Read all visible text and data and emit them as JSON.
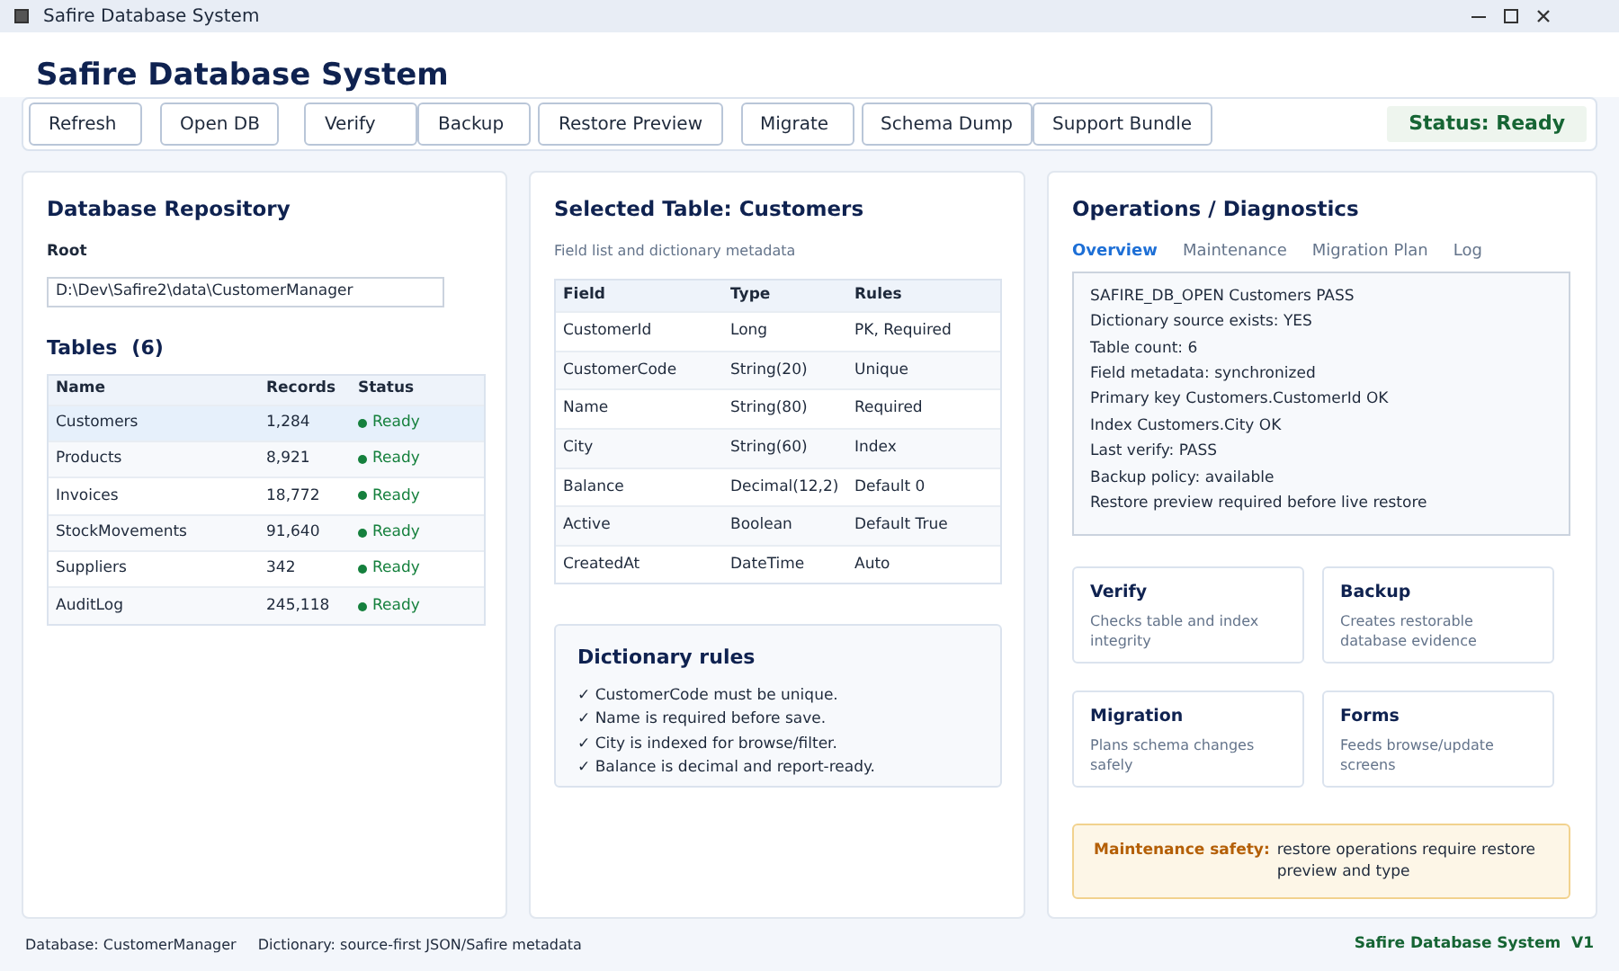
{
  "window": {
    "title": "Safire Database System"
  },
  "app_title": "Safire Database System",
  "toolbar": {
    "buttons": [
      "Refresh",
      "Open DB",
      "Verify",
      "Backup",
      "Restore Preview",
      "Migrate",
      "Schema Dump",
      "Support Bundle"
    ],
    "status": "Status: Ready"
  },
  "repository": {
    "title": "Database Repository",
    "root_label": "Root",
    "root_value": "D:\\Dev\\Safire2\\data\\CustomerManager",
    "tables_title": "Tables",
    "tables_count": "(6)",
    "columns": [
      "Name",
      "Records",
      "Status"
    ],
    "rows": [
      {
        "name": "Customers",
        "records": "1,284",
        "status": "Ready",
        "color": "#15803d",
        "selected": true
      },
      {
        "name": "Products",
        "records": "8,921",
        "status": "Ready",
        "color": "#15803d",
        "selected": false
      },
      {
        "name": "Invoices",
        "records": "18,772",
        "status": "Ready",
        "color": "#15803d",
        "selected": false
      },
      {
        "name": "StockMovements",
        "records": "91,640",
        "status": "Ready",
        "color": "#15803d",
        "selected": false
      },
      {
        "name": "Suppliers",
        "records": "342",
        "status": "Ready",
        "color": "#15803d",
        "selected": false
      },
      {
        "name": "AuditLog",
        "records": "245,118",
        "status": "Ready",
        "color": "#15803d",
        "selected": false
      }
    ]
  },
  "selected_table": {
    "title": "Selected Table: Customers",
    "subtitle": "Field list and dictionary metadata",
    "columns": [
      "Field",
      "Type",
      "Rules"
    ],
    "rows": [
      [
        "CustomerId",
        "Long",
        "PK, Required"
      ],
      [
        "CustomerCode",
        "String(20)",
        "Unique"
      ],
      [
        "Name",
        "String(80)",
        "Required"
      ],
      [
        "City",
        "String(60)",
        "Index"
      ],
      [
        "Balance",
        "Decimal(12,2)",
        "Default 0"
      ],
      [
        "Active",
        "Boolean",
        "Default True"
      ],
      [
        "CreatedAt",
        "DateTime",
        "Auto"
      ]
    ],
    "rules_title": "Dictionary rules",
    "rules": [
      "✓ CustomerCode must be unique.",
      "✓ Name is required before save.",
      "✓ City is indexed for browse/filter.",
      "✓ Balance is decimal and report-ready."
    ]
  },
  "operations": {
    "title": "Operations / Diagnostics",
    "tabs": [
      {
        "label": "Overview",
        "selected": true
      },
      {
        "label": "Maintenance",
        "selected": false
      },
      {
        "label": "Migration Plan",
        "selected": false
      },
      {
        "label": "Log",
        "selected": false
      }
    ],
    "log": [
      "SAFIRE_DB_OPEN Customers PASS",
      "Dictionary source exists: YES",
      "Table count: 6",
      "Field metadata: synchronized",
      "Primary key Customers.CustomerId OK",
      "Index Customers.City OK",
      "Last verify: PASS",
      "Backup policy: available",
      "Restore preview required before live restore"
    ],
    "cards": [
      {
        "title": "Verify",
        "text": "Checks table and index integrity"
      },
      {
        "title": "Backup",
        "text": "Creates restorable database evidence"
      },
      {
        "title": "Migration",
        "text": "Plans schema changes safely"
      },
      {
        "title": "Forms",
        "text": "Feeds browse/update screens"
      }
    ],
    "warning": {
      "label": "Maintenance safety:",
      "text": "restore operations require restore preview and type"
    }
  },
  "status_bar": {
    "database": "Database: CustomerManager",
    "dictionary": "Dictionary: source-first JSON/Safire metadata",
    "version": "Safire Database System  V1"
  }
}
